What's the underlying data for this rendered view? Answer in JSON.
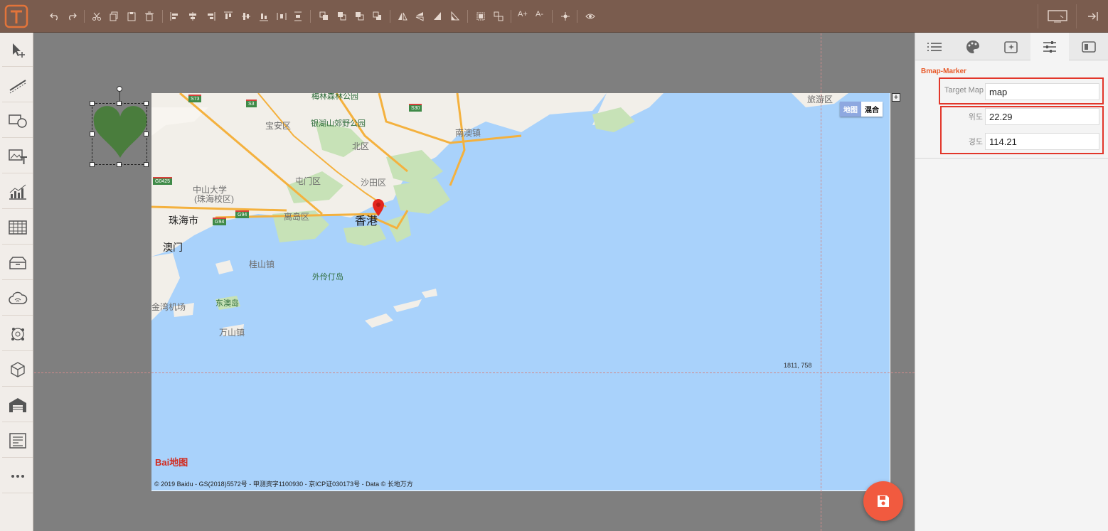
{
  "toolbar": {
    "app_logo": "T",
    "font_increase_label": "A+",
    "font_decrease_label": "A-"
  },
  "map": {
    "labels": [
      {
        "text": "香港",
        "style": "big",
        "id": "hongkong"
      },
      {
        "text": "澳门",
        "style": "mid",
        "id": "macau"
      },
      {
        "text": "珠海市",
        "style": "mid",
        "id": "zhuhai"
      },
      {
        "text": "宝安区",
        "style": "district",
        "id": "baoan"
      },
      {
        "text": "银湖山郊野公园",
        "style": "green",
        "id": "yinhushan-park"
      },
      {
        "text": "北区",
        "style": "district",
        "id": "north-district"
      },
      {
        "text": "南澳镇",
        "style": "district",
        "id": "nanao"
      },
      {
        "text": "屯门区",
        "style": "district",
        "id": "tuenmun"
      },
      {
        "text": "沙田区",
        "style": "district",
        "id": "shatin"
      },
      {
        "text": "离岛区",
        "style": "district",
        "id": "islands"
      },
      {
        "text": "中山大学",
        "style": "district",
        "id": "sysu"
      },
      {
        "text": "(珠海校区)",
        "style": "district",
        "id": "sysu-campus"
      },
      {
        "text": "桂山镇",
        "style": "district",
        "id": "guishan"
      },
      {
        "text": "外伶仃岛",
        "style": "green",
        "id": "wailingding"
      },
      {
        "text": "金湾机场",
        "style": "district",
        "id": "jinwan-airport"
      },
      {
        "text": "东澳岛",
        "style": "green",
        "id": "dongao"
      },
      {
        "text": "万山镇",
        "style": "district",
        "id": "wanshan"
      },
      {
        "text": "旅游区",
        "style": "district",
        "id": "tourist-area"
      },
      {
        "text": "梅林森林公园",
        "style": "green",
        "id": "meilin-park"
      }
    ],
    "road_badges": [
      "S73",
      "S3",
      "S30",
      "G0425",
      "G94",
      "G94"
    ],
    "maptype_map": "地图",
    "maptype_hybrid": "混合",
    "coord_readout": "1811, 758",
    "logo_text": "Bai地图",
    "copyright": "© 2019 Baidu - GS(2018)5572号 - 甲测资字1100930 - 京ICP证030173号 - Data © 长地万方"
  },
  "panel": {
    "title": "Bmap-Marker",
    "target_map_label": "Target Map",
    "target_map_value": "map",
    "lat_label": "위도",
    "lat_value": "22.29",
    "lng_label": "경도",
    "lng_value": "114.21"
  },
  "colors": {
    "toolbar_bg": "#7a5c4e",
    "accent": "#e85a2a",
    "fab": "#f15a3f",
    "marker_shape": "#4a7d3d",
    "map_water": "#a9d2fb",
    "highlight_box": "#e2362a"
  }
}
